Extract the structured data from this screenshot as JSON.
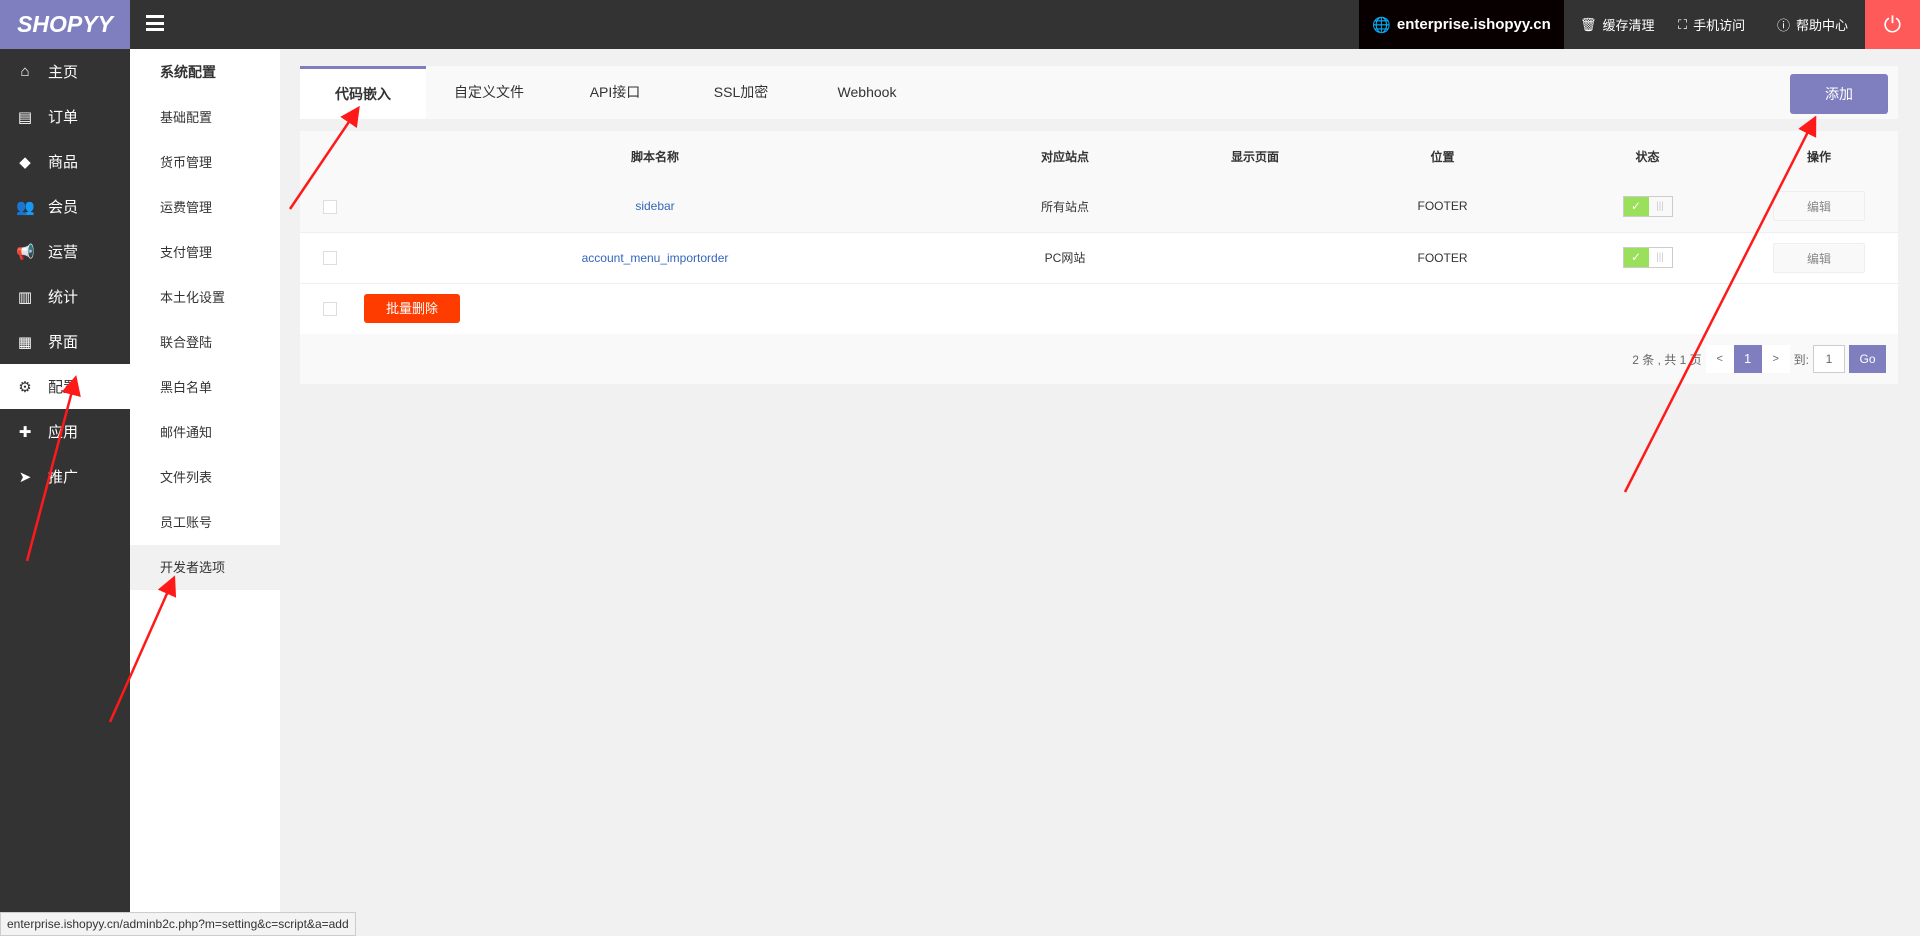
{
  "header": {
    "logo": "SHOPYY",
    "domain": "enterprise.ishopyy.cn",
    "links": [
      {
        "icon": "trash-icon",
        "label": "缓存清理"
      },
      {
        "icon": "scan-icon",
        "label": "手机访问"
      },
      {
        "icon": "help-icon",
        "label": "帮助中心"
      }
    ],
    "power_icon": "power-icon"
  },
  "sidebar": {
    "items": [
      {
        "icon": "home-icon",
        "label": "主页"
      },
      {
        "icon": "order-icon",
        "label": "订单"
      },
      {
        "icon": "box-icon",
        "label": "商品"
      },
      {
        "icon": "users-icon",
        "label": "会员"
      },
      {
        "icon": "megaphone-icon",
        "label": "运营"
      },
      {
        "icon": "chart-icon",
        "label": "统计"
      },
      {
        "icon": "store-icon",
        "label": "界面"
      },
      {
        "icon": "gear-icon",
        "label": "配置",
        "active": true
      },
      {
        "icon": "puzzle-icon",
        "label": "应用"
      },
      {
        "icon": "paper-plane-icon",
        "label": "推广"
      }
    ]
  },
  "submenu": {
    "title": "系统配置",
    "items": [
      "基础配置",
      "货币管理",
      "运费管理",
      "支付管理",
      "本土化设置",
      "联合登陆",
      "黑白名单",
      "邮件通知",
      "文件列表",
      "员工账号",
      "开发者选项"
    ],
    "active": "开发者选项"
  },
  "tabs": [
    "代码嵌入",
    "自定义文件",
    "API接口",
    "SSL加密",
    "Webhook"
  ],
  "active_tab": "代码嵌入",
  "add_label": "添加",
  "table": {
    "headers": [
      "脚本名称",
      "对应站点",
      "显示页面",
      "位置",
      "状态",
      "操作"
    ],
    "rows": [
      {
        "name": "sidebar",
        "site": "所有站点",
        "page": "",
        "position": "FOOTER",
        "enabled": true,
        "action": "编辑"
      },
      {
        "name": "account_menu_importorder",
        "site": "PC网站",
        "page": "",
        "position": "FOOTER",
        "enabled": true,
        "action": "编辑"
      }
    ],
    "batch_delete": "批量删除"
  },
  "pagination": {
    "summary": "2 条 , 共 1 页",
    "prev": "<",
    "current": "1",
    "next": ">",
    "goto_label": "到:",
    "goto_value": "1",
    "go": "Go"
  },
  "status_bar": "enterprise.ishopyy.cn/adminb2c.php?m=setting&c=script&a=add",
  "colors": {
    "accent": "#7f7fc0",
    "danger": "#ff3c00",
    "toggle_on": "#9be05a",
    "power": "#ff5a5a"
  }
}
